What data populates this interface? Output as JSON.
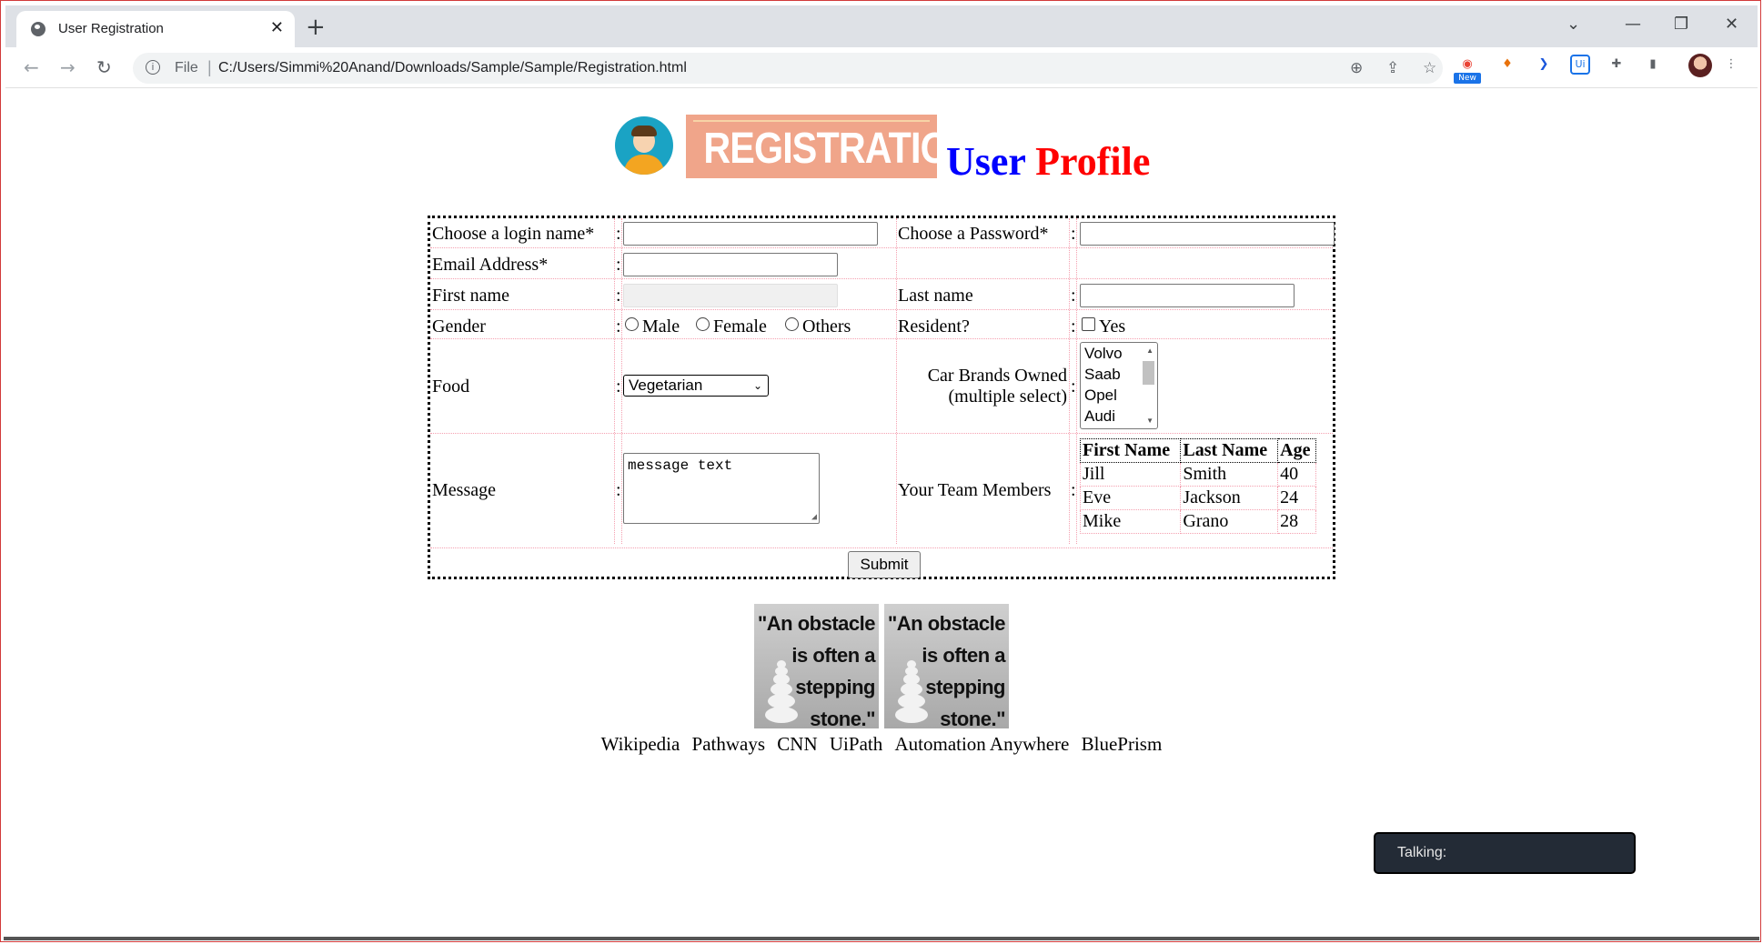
{
  "browser": {
    "tab_title": "User Registration",
    "url_scheme": "File",
    "url": "C:/Users/Simmi%20Anand/Downloads/Sample/Sample/Registration.html",
    "extension_badge": "New"
  },
  "header": {
    "banner_text": "REGISTRATION",
    "title_part1": "User",
    "title_part2": "Profile",
    "title_colors": [
      "#0000ff",
      "#ff0000"
    ]
  },
  "form": {
    "login_label": "Choose a login name*",
    "password_label": "Choose a Password*",
    "email_label": "Email Address*",
    "firstname_label": "First name",
    "lastname_label": "Last name",
    "gender_label": "Gender",
    "gender_options": [
      "Male",
      "Female",
      "Others"
    ],
    "resident_label": "Resident?",
    "resident_option": "Yes",
    "food_label": "Food",
    "food_selected": "Vegetarian",
    "cars_label_line1": "Car Brands Owned",
    "cars_label_line2": "(multiple select)",
    "cars_options": [
      "Volvo",
      "Saab",
      "Opel",
      "Audi"
    ],
    "message_label": "Message",
    "message_value": "message text",
    "team_label": "Your Team Members",
    "team_headers": [
      "First Name",
      "Last Name",
      "Age"
    ],
    "team_rows": [
      [
        "Jill",
        "Smith",
        "40"
      ],
      [
        "Eve",
        "Jackson",
        "24"
      ],
      [
        "Mike",
        "Grano",
        "28"
      ]
    ],
    "colon": ":",
    "submit_label": "Submit"
  },
  "quote": {
    "lines": [
      "\"An obstacle",
      "is often a",
      "stepping",
      "stone.\""
    ]
  },
  "links": [
    "Wikipedia",
    "Pathways",
    "CNN",
    "UiPath",
    "Automation Anywhere",
    "BluePrism"
  ],
  "overlay": {
    "talking_label": "Talking:"
  }
}
